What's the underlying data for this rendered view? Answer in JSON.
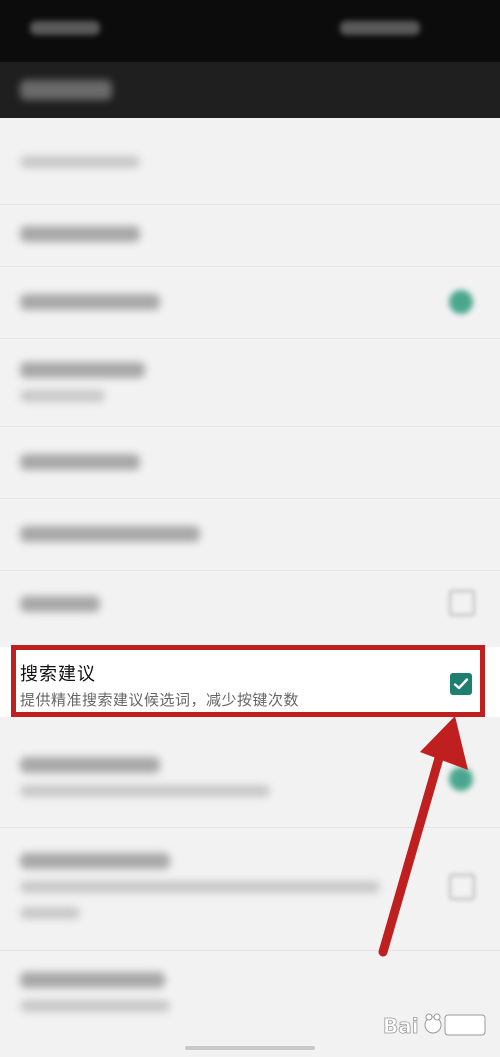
{
  "suggestion_setting": {
    "title": "搜索建议",
    "description": "提供精准搜索建议候选词，减少按键次数",
    "checked": true
  },
  "colors": {
    "accent": "#1e7f6e",
    "highlight_frame": "#c01f1f",
    "arrow": "#c01f1f"
  },
  "icons": {
    "checkbox": "check-icon",
    "watermark": "baidu-jingyan-watermark-icon"
  }
}
